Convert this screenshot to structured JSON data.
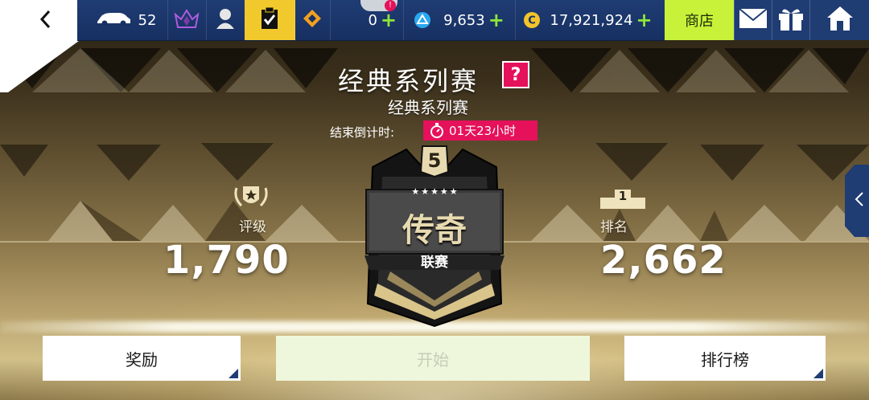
{
  "topbar": {
    "car_count": "52",
    "token_count": "0",
    "blue_currency": "9,653",
    "credits": "17,921,924",
    "shop_label": "商店",
    "plus": "+"
  },
  "header": {
    "title": "经典系列赛",
    "help": "?",
    "subtitle": "经典系列赛",
    "countdown_label": "结束倒计时:",
    "countdown_value": "01天23小时"
  },
  "rating": {
    "label": "评级",
    "value": "1,790"
  },
  "rank": {
    "label": "排名",
    "value": "2,662",
    "podium_num": "1"
  },
  "league": {
    "number": "5",
    "name": "传奇",
    "suffix": "联赛",
    "stars": 5
  },
  "buttons": {
    "rewards": "奖励",
    "start": "开始",
    "leaderboard": "排行榜"
  },
  "colors": {
    "accent_pink": "#e5115b",
    "shop_green": "#c8f23a",
    "bar_blue": "#1f3c73"
  }
}
